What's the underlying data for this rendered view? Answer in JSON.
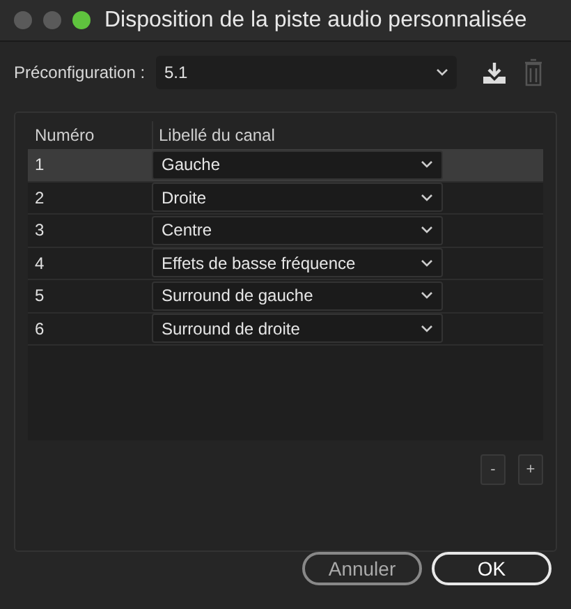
{
  "window": {
    "title": "Disposition de la piste audio personnalisée"
  },
  "preset": {
    "label": "Préconfiguration :",
    "value": "5.1"
  },
  "table": {
    "columns": [
      "Numéro",
      "Libellé du canal"
    ],
    "rows": [
      {
        "number": "1",
        "label": "Gauche",
        "selected": true
      },
      {
        "number": "2",
        "label": "Droite",
        "selected": false
      },
      {
        "number": "3",
        "label": "Centre",
        "selected": false
      },
      {
        "number": "4",
        "label": "Effets de basse fréquence",
        "selected": false
      },
      {
        "number": "5",
        "label": "Surround de gauche",
        "selected": false
      },
      {
        "number": "6",
        "label": "Surround de droite",
        "selected": false
      }
    ]
  },
  "row_buttons": [
    "-",
    "+"
  ],
  "buttons": [
    {
      "label": "Annuler",
      "kind": "secondary"
    },
    {
      "label": "OK",
      "kind": "primary"
    }
  ]
}
